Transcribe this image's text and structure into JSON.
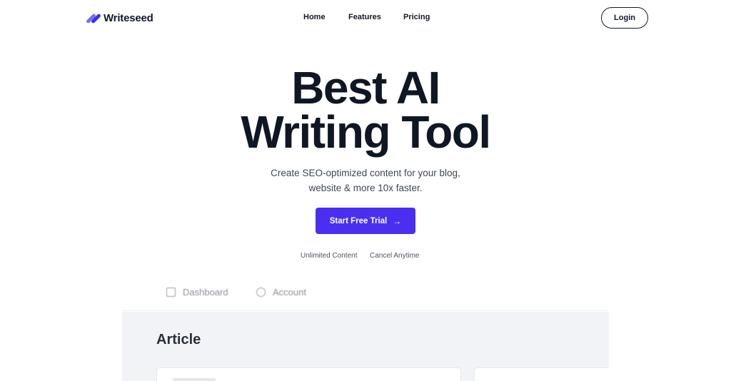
{
  "brand": {
    "name": "Writeseed",
    "colors": {
      "primary": "#4a2ff0",
      "text": "#0f1724",
      "logo_light": "#7b6cf6",
      "logo_dark": "#3b2cf0"
    }
  },
  "nav": {
    "items": [
      {
        "label": "Home"
      },
      {
        "label": "Features"
      },
      {
        "label": "Pricing"
      }
    ],
    "login_label": "Login"
  },
  "hero": {
    "title_line1": "Best AI",
    "title_line2": "Writing Tool",
    "subtitle_line1": "Create SEO-optimized content for your blog,",
    "subtitle_line2": "website & more 10x faster.",
    "cta_label": "Start Free Trial",
    "cta_icon": "arrow-right-icon",
    "perks": [
      "Unlimited Content",
      "Cancel Anytime"
    ]
  },
  "app_preview": {
    "tabs": [
      {
        "label": "Dashboard",
        "icon": "grid-icon"
      },
      {
        "label": "Account",
        "icon": "user-icon"
      }
    ],
    "heading": "Article"
  }
}
